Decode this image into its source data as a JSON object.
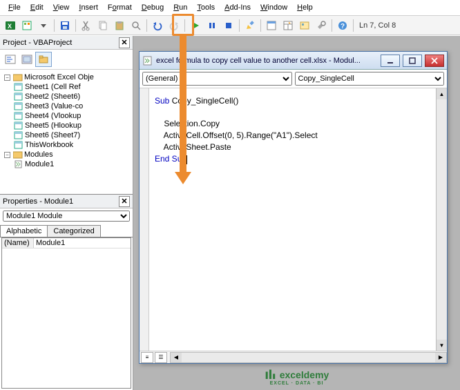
{
  "menu": {
    "file": "File",
    "edit": "Edit",
    "view": "View",
    "insert": "Insert",
    "format": "Format",
    "debug": "Debug",
    "run": "Run",
    "tools": "Tools",
    "addins": "Add-Ins",
    "window": "Window",
    "help": "Help"
  },
  "toolbar": {
    "status": "Ln 7, Col 8"
  },
  "project_panel": {
    "title": "Project - VBAProject",
    "root": "Microsoft Excel Obje",
    "sheets": [
      "Sheet1 (Cell Ref",
      "Sheet2 (Sheet6)",
      "Sheet3 (Value-co",
      "Sheet4 (Vlookup",
      "Sheet5 (Hlookup",
      "Sheet6 (Sheet7)"
    ],
    "workbook": "ThisWorkbook",
    "modules_label": "Modules",
    "module1": "Module1"
  },
  "properties_panel": {
    "title": "Properties - Module1",
    "object_select": "Module1 Module",
    "tab_alpha": "Alphabetic",
    "tab_cat": "Categorized",
    "name_key": "(Name)",
    "name_val": "Module1"
  },
  "code_window": {
    "title": "excel formula to copy cell value to another cell.xlsx - Modul...",
    "left_select": "(General)",
    "right_select": "Copy_SingleCell",
    "code": {
      "l1a": "Sub",
      "l1b": " Copy_SingleCell()",
      "l2": "",
      "l3": "    Selection.Copy",
      "l4": "    ActiveCell.Offset(0, 5).Range(\"A1\").Select",
      "l5": "    ActiveSheet.Paste",
      "l6a": "End Sub"
    }
  },
  "logo": {
    "brand": "exceldemy",
    "sub": "EXCEL · DATA · BI"
  }
}
